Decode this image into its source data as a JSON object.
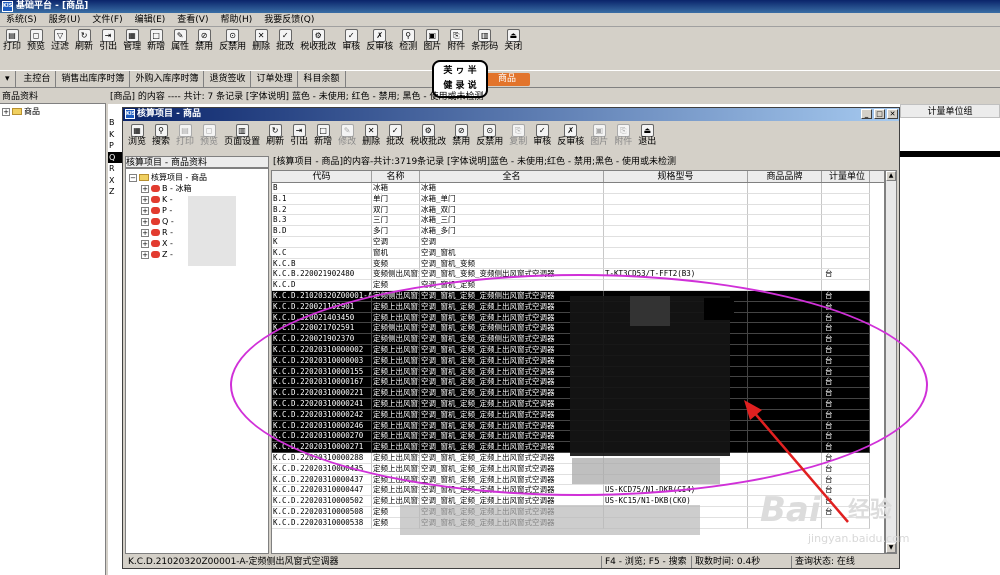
{
  "app": {
    "logo": "KIS",
    "title": "基础平台 - [商品]"
  },
  "menu": [
    "系统(S)",
    "服务(U)",
    "文件(F)",
    "编辑(E)",
    "查看(V)",
    "帮助(H)",
    "我要反馈(Q)"
  ],
  "main_toolbar": [
    {
      "label": "打印",
      "icon": "printer-icon",
      "glyph": "▤"
    },
    {
      "label": "预览",
      "icon": "preview-icon",
      "glyph": "◻"
    },
    {
      "label": "过滤",
      "icon": "filter-icon",
      "glyph": "▽"
    },
    {
      "label": "刷新",
      "icon": "refresh-icon",
      "glyph": "↻"
    },
    {
      "label": "引出",
      "icon": "export-icon",
      "glyph": "⇥"
    },
    {
      "label": "管理",
      "icon": "manage-icon",
      "glyph": "▦"
    },
    {
      "label": "新增",
      "icon": "new-icon",
      "glyph": "□"
    },
    {
      "label": "属性",
      "icon": "properties-icon",
      "glyph": "✎"
    },
    {
      "label": "禁用",
      "icon": "disable-icon",
      "glyph": "⊘"
    },
    {
      "label": "反禁用",
      "icon": "enable-icon",
      "glyph": "⊙"
    },
    {
      "label": "删除",
      "icon": "delete-icon",
      "glyph": "✕"
    },
    {
      "label": "批改",
      "icon": "batch-edit-icon",
      "glyph": "✓"
    },
    {
      "label": "税收批改",
      "icon": "tax-batch-icon",
      "glyph": "⚙"
    },
    {
      "label": "审核",
      "icon": "approve-icon",
      "glyph": "✓"
    },
    {
      "label": "反审核",
      "icon": "unapprove-icon",
      "glyph": "✗"
    },
    {
      "label": "检测",
      "icon": "check-icon",
      "glyph": "⚲"
    },
    {
      "label": "图片",
      "icon": "image-icon",
      "glyph": "▣"
    },
    {
      "label": "附件",
      "icon": "attachment-icon",
      "glyph": "⎘"
    },
    {
      "label": "条形码",
      "icon": "barcode-icon",
      "glyph": "▥"
    },
    {
      "label": "关闭",
      "icon": "close-icon",
      "glyph": "⏏"
    }
  ],
  "nav_tabs": [
    "主控台",
    "销售出库序时簿",
    "外购入库序时簿",
    "退货签收",
    "订单处理",
    "科目余额"
  ],
  "nav_active_tab": "商品",
  "sticker_lines": [
    "芙 ヮ 半",
    "健 录 说"
  ],
  "left_panel": {
    "header": "商品资料",
    "tree_root": "商品"
  },
  "bg_status": "[商品] 的内容 ---- 共计: 7 条记录  [字体说明] 蓝色 - 未使用; 红色 - 禁用; 黑色 - 使用或未检测",
  "bg_column": "计量单位组",
  "bg_letters": [
    "B",
    "K",
    "P",
    "Q",
    "R",
    "X",
    "Z"
  ],
  "dialog": {
    "logo": "KIS",
    "title": "核算项目 - 商品",
    "toolbar": [
      {
        "label": "浏览",
        "icon": "browse-icon",
        "glyph": "▦",
        "enabled": true
      },
      {
        "label": "搜索",
        "icon": "search-icon",
        "glyph": "⚲",
        "enabled": true
      },
      {
        "label": "打印",
        "icon": "printer-icon",
        "glyph": "▤",
        "enabled": false
      },
      {
        "label": "预览",
        "icon": "preview-icon",
        "glyph": "◻",
        "enabled": false
      },
      {
        "label": "页面设置",
        "icon": "page-setup-icon",
        "glyph": "▥",
        "enabled": true
      },
      {
        "label": "刷新",
        "icon": "refresh-icon",
        "glyph": "↻",
        "enabled": true
      },
      {
        "label": "引出",
        "icon": "export-icon",
        "glyph": "⇥",
        "enabled": true
      },
      {
        "label": "新增",
        "icon": "new-icon",
        "glyph": "□",
        "enabled": true
      },
      {
        "label": "修改",
        "icon": "edit-icon",
        "glyph": "✎",
        "enabled": false
      },
      {
        "label": "删除",
        "icon": "delete-icon",
        "glyph": "✕",
        "enabled": true
      },
      {
        "label": "批改",
        "icon": "batch-edit-icon",
        "glyph": "✓",
        "enabled": true
      },
      {
        "label": "税收批改",
        "icon": "tax-batch-icon",
        "glyph": "⚙",
        "enabled": true
      },
      {
        "label": "禁用",
        "icon": "disable-icon",
        "glyph": "⊘",
        "enabled": true
      },
      {
        "label": "反禁用",
        "icon": "enable-icon",
        "glyph": "⊙",
        "enabled": true
      },
      {
        "label": "复制",
        "icon": "copy-icon",
        "glyph": "⎘",
        "enabled": false
      },
      {
        "label": "审核",
        "icon": "approve-icon",
        "glyph": "✓",
        "enabled": true
      },
      {
        "label": "反审核",
        "icon": "unapprove-icon",
        "glyph": "✗",
        "enabled": true
      },
      {
        "label": "图片",
        "icon": "image-icon",
        "glyph": "▣",
        "enabled": false
      },
      {
        "label": "附件",
        "icon": "attachment-icon",
        "glyph": "⎘",
        "enabled": false
      },
      {
        "label": "退出",
        "icon": "exit-icon",
        "glyph": "⏏",
        "enabled": true
      }
    ],
    "left_header": "核算项目 - 商品资料",
    "tree_root": "核算项目 - 商品",
    "tree_items": [
      "B - 冰箱",
      "K -",
      "P -",
      "Q -",
      "R -",
      "X -",
      "Z -"
    ],
    "status": "[核算项目 - 商品]的内容-共计:3719条记录  [字体说明]蓝色 - 未使用;红色 - 禁用;黑色 - 使用或未检测",
    "columns": [
      "代码",
      "名称",
      "全名",
      "规格型号",
      "商品品牌",
      "计量单位"
    ],
    "rows": [
      {
        "code": "B",
        "name": "冰箱",
        "full": "冰箱",
        "spec": "",
        "brand": "",
        "unit": "",
        "sel": false
      },
      {
        "code": "B.1",
        "name": "单门",
        "full": "冰箱_单门",
        "spec": "",
        "brand": "",
        "unit": "",
        "sel": false
      },
      {
        "code": "B.2",
        "name": "双门",
        "full": "冰箱_双门",
        "spec": "",
        "brand": "",
        "unit": "",
        "sel": false
      },
      {
        "code": "B.3",
        "name": "三门",
        "full": "冰箱_三门",
        "spec": "",
        "brand": "",
        "unit": "",
        "sel": false
      },
      {
        "code": "B.D",
        "name": "多门",
        "full": "冰箱_多门",
        "spec": "",
        "brand": "",
        "unit": "",
        "sel": false
      },
      {
        "code": "K",
        "name": "空调",
        "full": "空调",
        "spec": "",
        "brand": "",
        "unit": "",
        "sel": false
      },
      {
        "code": "K.C",
        "name": "窗机",
        "full": "空调_窗机",
        "spec": "",
        "brand": "",
        "unit": "",
        "sel": false
      },
      {
        "code": "K.C.B",
        "name": "变频",
        "full": "空调_窗机_变频",
        "spec": "",
        "brand": "",
        "unit": "",
        "sel": false
      },
      {
        "code": "K.C.B.220021902480",
        "name": "变频侧出风窗式",
        "full": "空调_窗机_变频_变频侧出风窗式空调器",
        "spec": "T-KT3CD53/T-FFT2(B3)",
        "brand": "",
        "unit": "台",
        "sel": false
      },
      {
        "code": "K.C.D",
        "name": "定频",
        "full": "空调_窗机_定频",
        "spec": "",
        "brand": "",
        "unit": "",
        "sel": false
      },
      {
        "code": "K.C.D.21020320Z00001-A",
        "name": "定频侧出风窗式",
        "full": "空调_窗机_定频_定频侧出风窗式空调器",
        "spec": "",
        "brand": "",
        "unit": "台",
        "sel": true
      },
      {
        "code": "K.C.D.220021102901",
        "name": "定频上出风窗式",
        "full": "空调_窗机_定频_定频上出风窗式空调器",
        "spec": "",
        "brand": "",
        "unit": "台",
        "sel": true
      },
      {
        "code": "K.C.D.220021403450",
        "name": "定频上出风窗式",
        "full": "空调_窗机_定频_定频上出风窗式空调器",
        "spec": "",
        "brand": "",
        "unit": "台",
        "sel": true
      },
      {
        "code": "K.C.D.220021702591",
        "name": "定频侧出风窗式",
        "full": "空调_窗机_定频_定频侧出风窗式空调器",
        "spec": "",
        "brand": "",
        "unit": "台",
        "sel": true
      },
      {
        "code": "K.C.D.220021902370",
        "name": "定频侧出风窗式",
        "full": "空调_窗机_定频_定频侧出风窗式空调器",
        "spec": "",
        "brand": "",
        "unit": "台",
        "sel": true
      },
      {
        "code": "K.C.D.22020310000002",
        "name": "定频上出风窗式",
        "full": "空调_窗机_定频_定频上出风窗式空调器",
        "spec": "",
        "brand": "",
        "unit": "台",
        "sel": true
      },
      {
        "code": "K.C.D.22020310000003",
        "name": "定频上出风窗式",
        "full": "空调_窗机_定频_定频上出风窗式空调器",
        "spec": "",
        "brand": "",
        "unit": "台",
        "sel": true
      },
      {
        "code": "K.C.D.22020310000155",
        "name": "定频上出风窗式",
        "full": "空调_窗机_定频_定频上出风窗式空调器",
        "spec": "",
        "brand": "",
        "unit": "台",
        "sel": true
      },
      {
        "code": "K.C.D.22020310000167",
        "name": "定频上出风窗式",
        "full": "空调_窗机_定频_定频上出风窗式空调器",
        "spec": "",
        "brand": "",
        "unit": "台",
        "sel": true
      },
      {
        "code": "K.C.D.22020310000221",
        "name": "定频上出风窗式",
        "full": "空调_窗机_定频_定频上出风窗式空调器",
        "spec": "",
        "brand": "",
        "unit": "台",
        "sel": true
      },
      {
        "code": "K.C.D.22020310000241",
        "name": "定频上出风窗式",
        "full": "空调_窗机_定频_定频上出风窗式空调器",
        "spec": "",
        "brand": "",
        "unit": "台",
        "sel": true
      },
      {
        "code": "K.C.D.22020310000242",
        "name": "定频上出风窗式",
        "full": "空调_窗机_定频_定频上出风窗式空调器",
        "spec": "",
        "brand": "",
        "unit": "台",
        "sel": true
      },
      {
        "code": "K.C.D.22020310000246",
        "name": "定频上出风窗式",
        "full": "空调_窗机_定频_定频上出风窗式空调器",
        "spec": "",
        "brand": "",
        "unit": "台",
        "sel": true
      },
      {
        "code": "K.C.D.22020310000270",
        "name": "定频上出风窗式",
        "full": "空调_窗机_定频_定频上出风窗式空调器",
        "spec": "",
        "brand": "",
        "unit": "台",
        "sel": true
      },
      {
        "code": "K.C.D.22020310000271",
        "name": "定频上出风窗式",
        "full": "空调_窗机_定频_定频上出风窗式空调器",
        "spec": "",
        "brand": "",
        "unit": "台",
        "sel": true
      },
      {
        "code": "K.C.D.22020310000288",
        "name": "定频上出风窗式",
        "full": "空调_窗机_定频_定频上出风窗式空调器",
        "spec": "",
        "brand": "",
        "unit": "台",
        "sel": false
      },
      {
        "code": "K.C.D.22020310000435",
        "name": "定频上出风窗式",
        "full": "空调_窗机_定频_定频上出风窗式空调器",
        "spec": "",
        "brand": "",
        "unit": "台",
        "sel": false
      },
      {
        "code": "K.C.D.22020310000437",
        "name": "定频上出风窗式",
        "full": "空调_窗机_定频_定频上出风窗式空调器",
        "spec": "",
        "brand": "",
        "unit": "台",
        "sel": false
      },
      {
        "code": "K.C.D.22020310000447",
        "name": "定频上出风窗式",
        "full": "空调_窗机_定频_定频上出风窗式空调器",
        "spec": "US-KCD75/N1-DKB(CI4)",
        "brand": "",
        "unit": "台",
        "sel": false
      },
      {
        "code": "K.C.D.22020310000502",
        "name": "定频上出风窗式",
        "full": "空调_窗机_定频_定频上出风窗式空调器",
        "spec": "US-KC15/N1-DKB(CK0)",
        "brand": "",
        "unit": "台",
        "sel": false
      },
      {
        "code": "K.C.D.22020310000508",
        "name": "定频",
        "full": "空调_窗机_定频_定频上出风窗式空调器",
        "spec": "",
        "brand": "",
        "unit": "台",
        "sel": false
      },
      {
        "code": "K.C.D.22020310000538",
        "name": "定频",
        "full": "空调_窗机_定频_定频上出风窗式空调器",
        "spec": "",
        "brand": "",
        "unit": "",
        "sel": false
      }
    ],
    "footer": {
      "selected": "K.C.D.21020320Z00001-A-定频侧出风窗式空调器",
      "hint": "F4 - 浏览; F5 - 搜索",
      "fetch": "取数时间: 0.4秒",
      "query": "查询状态: 在线"
    }
  },
  "watermark": {
    "brand": "Bai",
    "cn": "经验",
    "url": "jingyan.baidu.com"
  },
  "colors": {
    "selection": "#000000",
    "annotation": "#d030d8",
    "arrow": "#e02020",
    "title_bar": "#0a246a",
    "active_tab": "#e2742c"
  }
}
